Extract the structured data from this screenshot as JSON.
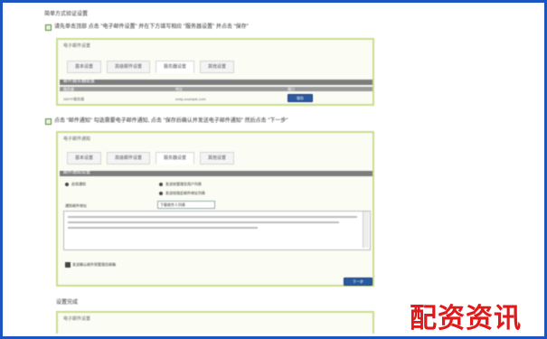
{
  "section1": {
    "heading": "简单方式验证设置",
    "step_text": "请先单击顶部 点击 \"电子邮件设置\" 并在下方填写相应 \"服务器设置\" 并点击 \"保存\"",
    "panel_title": "电子邮件设置",
    "tabs": [
      "基本设置",
      "高级邮件设置",
      "服务器设置",
      "其他设置"
    ],
    "active_tab": 2,
    "table_header": "邮件服务器配置",
    "columns": [
      "服务器",
      "地址",
      "端口"
    ],
    "row": [
      "SMTP服务器",
      "smtp.example.com",
      "保存"
    ]
  },
  "section2": {
    "step_text": "点击 \"邮件通知\" 勾选需要电子邮件通知, 点击 \"保存后确认并发送电子邮件通知\" 然后点击 \"下一步\"",
    "panel_title": "电子邮件通知",
    "tabs": [
      "基本设置",
      "高级邮件设置",
      "服务器设置",
      "其他设置"
    ],
    "active_tab": 2,
    "table_header": "邮件通知设置",
    "options": [
      "启用通知",
      "发送给管理员用户列表",
      "发送给指定邮件地址列表"
    ],
    "field_label": "通知邮件地址",
    "field_button": "下载收件人列表",
    "checkbox_label": "发送确认邮件到管理员邮箱",
    "next_button": "下一步"
  },
  "section3": {
    "heading": "设置完成",
    "panel_title": "电子邮件设置"
  },
  "watermark": "配资资讯",
  "colors": {
    "frame": "#1a55c0",
    "panel_border": "#c9dc8c",
    "button": "#2b5aa0",
    "watermark": "#e0191b"
  }
}
